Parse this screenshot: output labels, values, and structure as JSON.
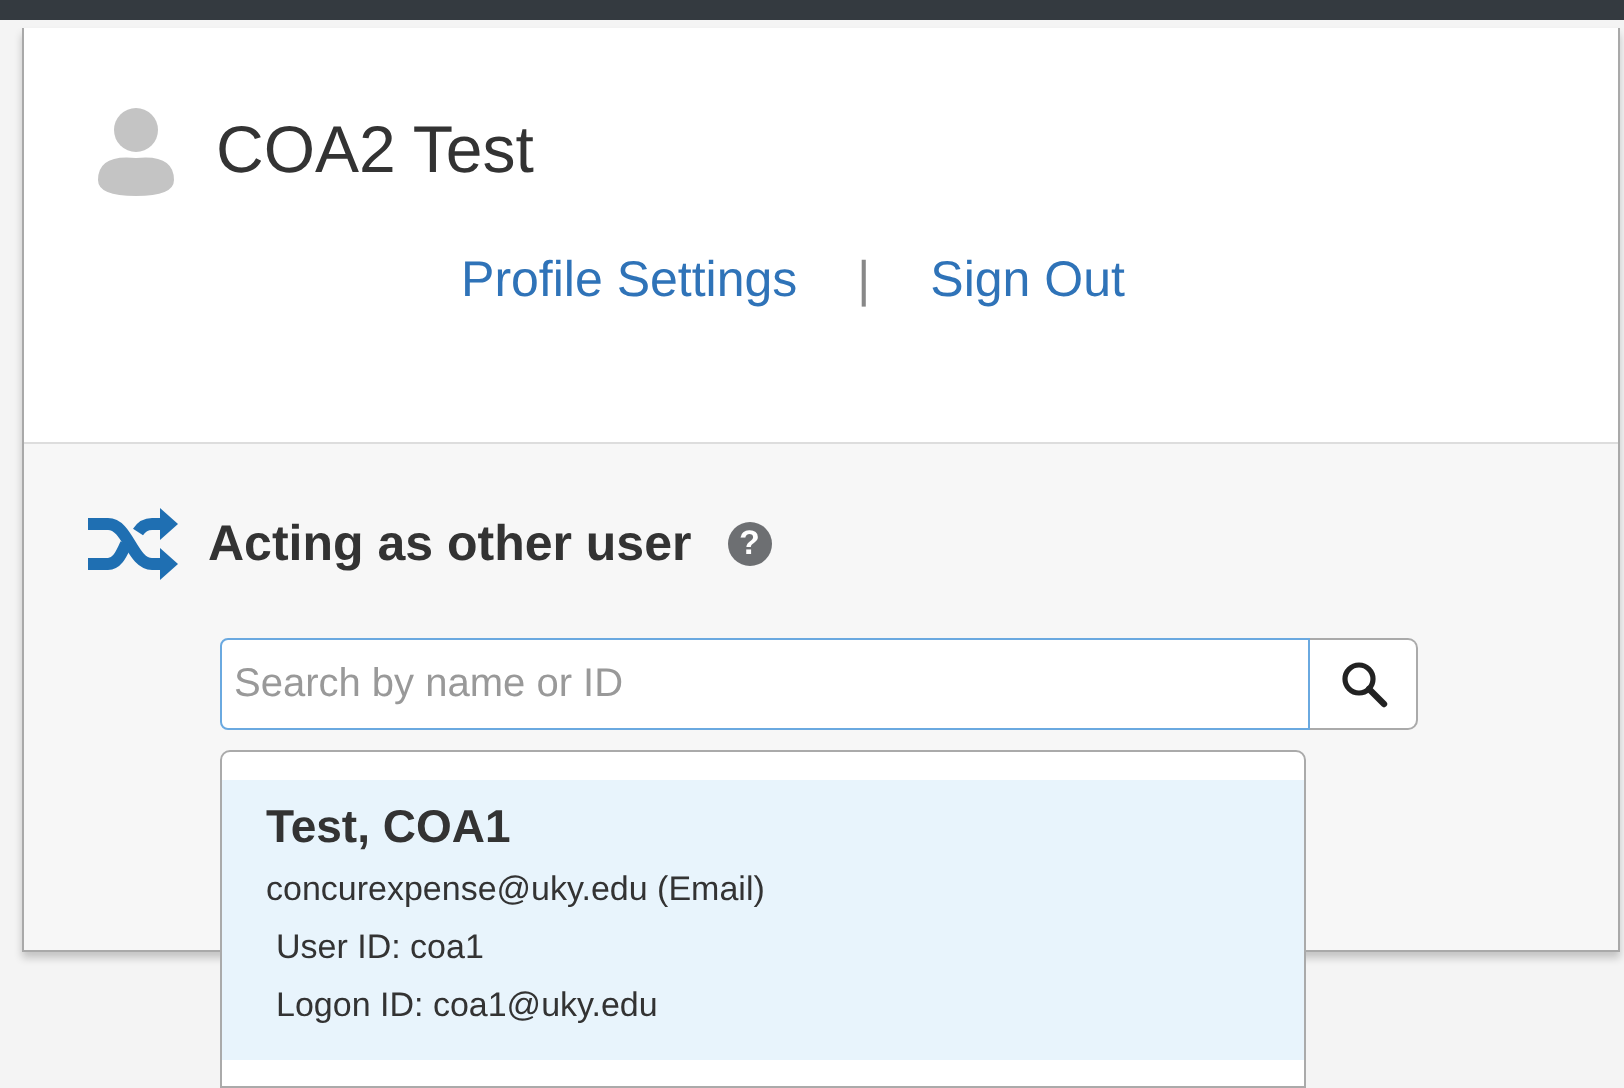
{
  "profile": {
    "name": "COA2 Test",
    "links": [
      "Profile Settings",
      "Sign Out"
    ],
    "separator": "|"
  },
  "acting_as": {
    "title": "Acting as other user",
    "help_icon": "?",
    "search": {
      "placeholder": "Search by name or ID"
    },
    "results": [
      {
        "name": "Test, COA1",
        "email": "concurexpense@uky.edu (Email)",
        "user_id": "User ID: coa1",
        "logon_id": "Logon ID: coa1@uky.edu",
        "selected": true
      }
    ]
  }
}
